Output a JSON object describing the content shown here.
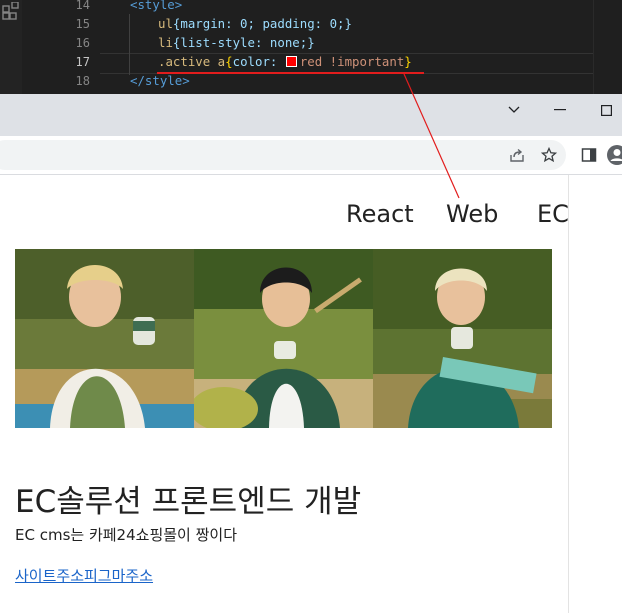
{
  "editor": {
    "line_numbers": [
      "14",
      "15",
      "16",
      "17",
      "18"
    ],
    "current_line": "17",
    "lines": {
      "l14": "<style>",
      "l15_sel": "ul",
      "l15_body": "{margin: 0; padding: 0;}",
      "l16_sel": "li",
      "l16_body": "{list-style: none;}",
      "l17_sel": ".active a",
      "l17_open": "{",
      "l17_prop": "color:",
      "l17_val": "red !important",
      "l17_close": "}",
      "l18": "</style>"
    },
    "swatch_color": "#ff0000"
  },
  "window": {
    "dropdown_glyph": "⌄",
    "minimize_glyph": "─",
    "maximize_glyph": "☐"
  },
  "page": {
    "nav": {
      "item1": "React",
      "item2": "Web",
      "item3": "EC"
    },
    "headline": "EC솔루션 프론트엔드 개발",
    "description": "EC cms는 카페24쇼핑몰이 짱이다",
    "link": "사이트주소피그마주소"
  },
  "colors": {
    "active_nav": "#ff0000",
    "annotation": "#e21d1d",
    "link": "#1a64c9"
  }
}
